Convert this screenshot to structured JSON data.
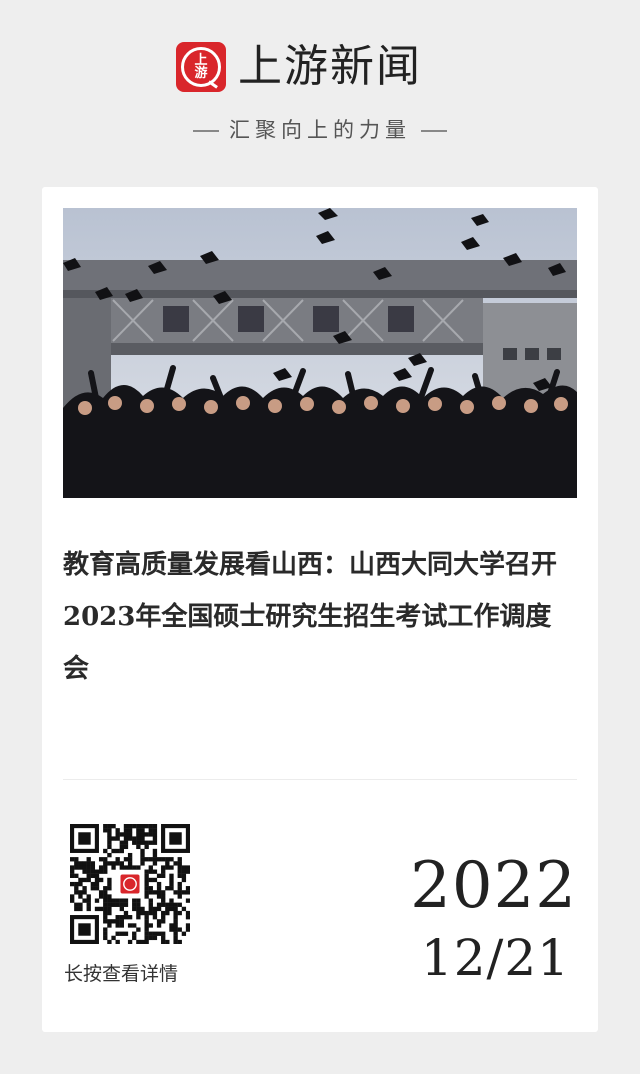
{
  "header": {
    "logo_glyph": "上\n游",
    "brand_name": "上游新闻",
    "slogan": "汇聚向上的力量",
    "brand_color": "#d9262b"
  },
  "card": {
    "hero_image": "graduates-throwing-caps-photo",
    "title": "教育高质量发展看山西：山西大同大学召开2023年全国硕士研究生招生考试工作调度会",
    "qr_caption": "长按查看详情",
    "date_year": "2022",
    "date_month_day": "12/21"
  }
}
